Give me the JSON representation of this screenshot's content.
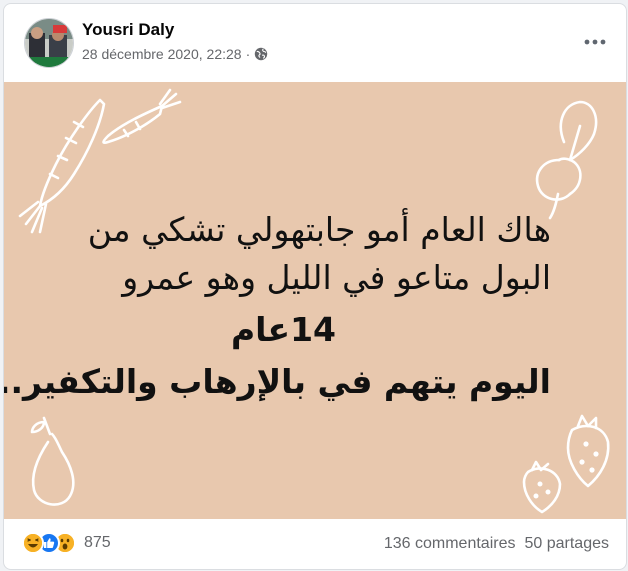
{
  "post": {
    "author": "Yousri Daly",
    "timestamp": "28 décembre 2020, 22:28",
    "separator": "·",
    "visibility_icon": "globe-icon",
    "more_icon": "more-dots-icon"
  },
  "image": {
    "background": "#e8c8ae",
    "lines": [
      "هاك العام أمو جابتهولي تشكي من",
      "البول متاعو في الليل وهو عمرو",
      "14عام",
      "اليوم يتهم في بالإرهاب والتكفير..."
    ]
  },
  "footer": {
    "reaction_icons": [
      "haha-icon",
      "like-icon",
      "wow-icon"
    ],
    "reaction_count": "875",
    "comments": "136 commentaires",
    "shares": "50 partages"
  },
  "colors": {
    "like": "#1877f2",
    "emoji": "#f7b125",
    "text_secondary": "#65676b"
  }
}
